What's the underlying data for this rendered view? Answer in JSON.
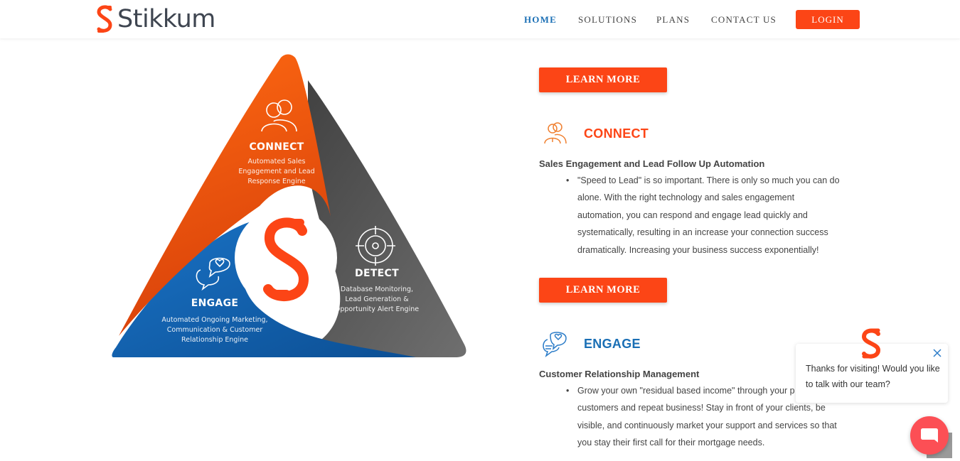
{
  "brand": {
    "name": "Stikkum",
    "accent": "#fc4516",
    "blue": "#1a6fb5"
  },
  "nav": {
    "items": [
      {
        "label": "HOME",
        "active": true
      },
      {
        "label": "SOLUTIONS",
        "active": false
      },
      {
        "label": "PLANS",
        "active": false
      },
      {
        "label": "CONTACT US",
        "active": false
      }
    ],
    "login": "LOGIN"
  },
  "triangle": {
    "connect": {
      "title": "CONNECT",
      "desc": [
        "Automated Sales",
        "Engagement and Lead",
        "Response Engine"
      ]
    },
    "detect": {
      "title": "DETECT",
      "desc": [
        "Database Monitoring,",
        "Lead Generation  &",
        "Opportunity Alert Engine"
      ]
    },
    "engage": {
      "title": "ENGAGE",
      "desc": [
        "Automated Ongoing Marketing,",
        "Communication & Customer",
        "Relationship Engine"
      ]
    }
  },
  "features": {
    "learn_more_1": "LEARN MORE",
    "connect": {
      "title": "CONNECT",
      "color": "#fc4516",
      "icon": "people-icon",
      "subtitle": "Sales Engagement and Lead Follow Up Automation",
      "lines": [
        "\"Speed to Lead\" is so important. There is only so much you can do",
        "alone.  With the right technology and sales engagement",
        "automation, you can respond and engage lead quickly and",
        "systematically, resulting in an increase your connection success",
        "dramatically.  Increasing your business success exponentially!"
      ]
    },
    "learn_more_2": "LEARN MORE",
    "engage": {
      "title": "ENGAGE",
      "color": "#1a6fb5",
      "icon": "chat-heart-icon",
      "subtitle": "Customer Relationship Management",
      "lines": [
        "Grow your own \"residual based income\" through your p",
        "customers and repeat business!  Stay in front of your clients, be",
        "visible, and continuously market your support and services so that",
        "you stay their first call for their mortgage needs."
      ]
    }
  },
  "chat": {
    "message": "Thanks for visiting! Would you like to talk with our team?"
  }
}
